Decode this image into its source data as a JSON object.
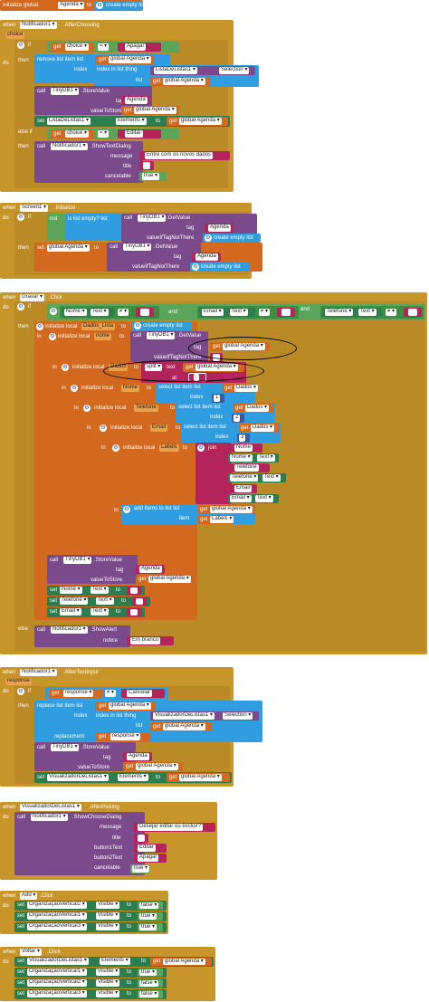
{
  "init": {
    "kw": "initialize global",
    "name": "Agenda",
    "to": "to",
    "val": "create empty list"
  },
  "ev1": {
    "when": "when",
    "comp": "Notificador1",
    "evt": ".AfterChoosing",
    "param": "choice",
    "do": "do",
    "if": "if",
    "get": "get",
    "var": "choice",
    "eq": "=",
    "apagar": "Apagar",
    "then": "then",
    "remove": "remove list item list",
    "listvar": "global Agenda",
    "index": "index",
    "indexinlist": "index in list thing",
    "lv": "ListaDeListas1",
    "sel": "Selection",
    "list": "list",
    "call": "call",
    "db": "TinyDB1",
    "store": ".StoreValue",
    "tag": "tag",
    "tagv": "Agenda",
    "vts": "valueToStore",
    "set": "set",
    "lvset": "ListaDeListas1",
    "elements": "Elements",
    "toword": "to",
    "elseif": "else if",
    "editar": "Editar",
    "showtext": ".ShowTextDialog",
    "message": "message",
    "msg": "Entre com os novos dados",
    "title": "title",
    "cancelable": "cancelable",
    "true": "true"
  },
  "ev2": {
    "when": "when",
    "comp": "Screen1",
    "evt": ".Initialize",
    "do": "do",
    "if": "if",
    "not": "not",
    "isempty": "is list empty? list",
    "call": "call",
    "db": "TinyDB1",
    "getv": ".GetValue",
    "tag": "tag",
    "tagv": "Agenda",
    "vitn": "valueIfTagNotThere",
    "cel": "create empty list",
    "then": "then",
    "set": "set",
    "gv": "global Agenda",
    "to": "to"
  },
  "ev3": {
    "when": "when",
    "comp": "Gravar",
    "evt": ".Click",
    "do": "do",
    "if": "if",
    "nome": "Nome",
    "text": "Text",
    "neq": "≠",
    "and": "and",
    "email": "Email",
    "telefone": "Telefone",
    "then": "then",
    "initlocal": "initialize local",
    "dl": "Dados_Lista",
    "to": "to",
    "cel": "create empty list",
    "in": "in",
    "nomevar": "nome",
    "call": "call",
    "db": "TinyDB1",
    "getv": ".GetValue",
    "tag": "tag",
    "get": "get",
    "ga": "global Agenda",
    "vitn": "valueIfTagNotThere",
    "dados": "Dados",
    "split": "split",
    "textw": "text",
    "at": "at",
    "comma": ",",
    "select": "select list item list",
    "index": "index",
    "n1": "1",
    "n2": "2",
    "n3": "3",
    "telvar": "Telefone",
    "emailvar": "Email",
    "labels": "Labels",
    "join": "join",
    "add": "add items to list list",
    "item": "item",
    "store": ".StoreValue",
    "tagv": "Agenda",
    "vts": "valueToStore",
    "set": "set",
    "else": "else",
    "notif": "Notificador1",
    "alert": ".ShowAlert",
    "notice": "notice",
    "branco": "Em branco"
  },
  "ev4": {
    "when": "when",
    "comp": "Notificador1",
    "evt": ".AfterTextInput",
    "param": "response",
    "do": "do",
    "if": "if",
    "get": "get",
    "resp": "response",
    "neq": "≠",
    "cancelar": "Cancelar",
    "then": "then",
    "replace": "replace list item list",
    "ga": "global Agenda",
    "index": "index",
    "indexinlist": "index in list thing",
    "lv": "VisualizadorDeListas1",
    "sel": "Selection",
    "list": "list",
    "replacement": "replacement",
    "call": "call",
    "db": "TinyDB1",
    "store": ".StoreValue",
    "tag": "tag",
    "tagv": "Agenda",
    "vts": "valueToStore",
    "set": "set",
    "elements": "Elements",
    "to": "to"
  },
  "ev5": {
    "when": "when",
    "comp": "VisualizadorDeListas1",
    "evt": ".AfterPicking",
    "do": "do",
    "call": "call",
    "notif": "Notificador1",
    "choose": ".ShowChooseDialog",
    "message": "message",
    "msg": "Desejar editar ou excluir?",
    "title": "title",
    "b1": "button1Text",
    "editar": "Editar",
    "b2": "button2Text",
    "apagar": "Apagar",
    "cancelable": "cancelable",
    "true": "true"
  },
  "ev6": {
    "when": "when",
    "comp": "Add",
    "evt": ".Click",
    "do": "do",
    "set": "set",
    "o1": "OrganizaçãoVertical2",
    "o2": "OrganizaçãoVertical1",
    "o3": "OrganizaçãoVertical3",
    "visible": "Visible",
    "to": "to",
    "false": "false",
    "true": "true"
  },
  "ev7": {
    "when": "when",
    "comp": "Voltar",
    "evt": ".Click",
    "do": "do",
    "set": "set",
    "lv": "VisualizadorDeListas1",
    "elements": "Elements",
    "to": "to",
    "get": "get",
    "ga": "global Agenda",
    "o1": "OrganizaçãoVertical1",
    "o2": "OrganizaçãoVertical2",
    "o3": "OrganizaçãoVertical3",
    "visible": "Visible",
    "true": "true",
    "false": "false"
  },
  "colors": {
    "event": "#c8952a",
    "control": "#b98a26",
    "logic": "#5ba55b",
    "variable": "#d2691e",
    "component": "#7b4a8b",
    "list": "#2f9de0",
    "text": "#b3245a",
    "setter": "#2e7d4f"
  }
}
